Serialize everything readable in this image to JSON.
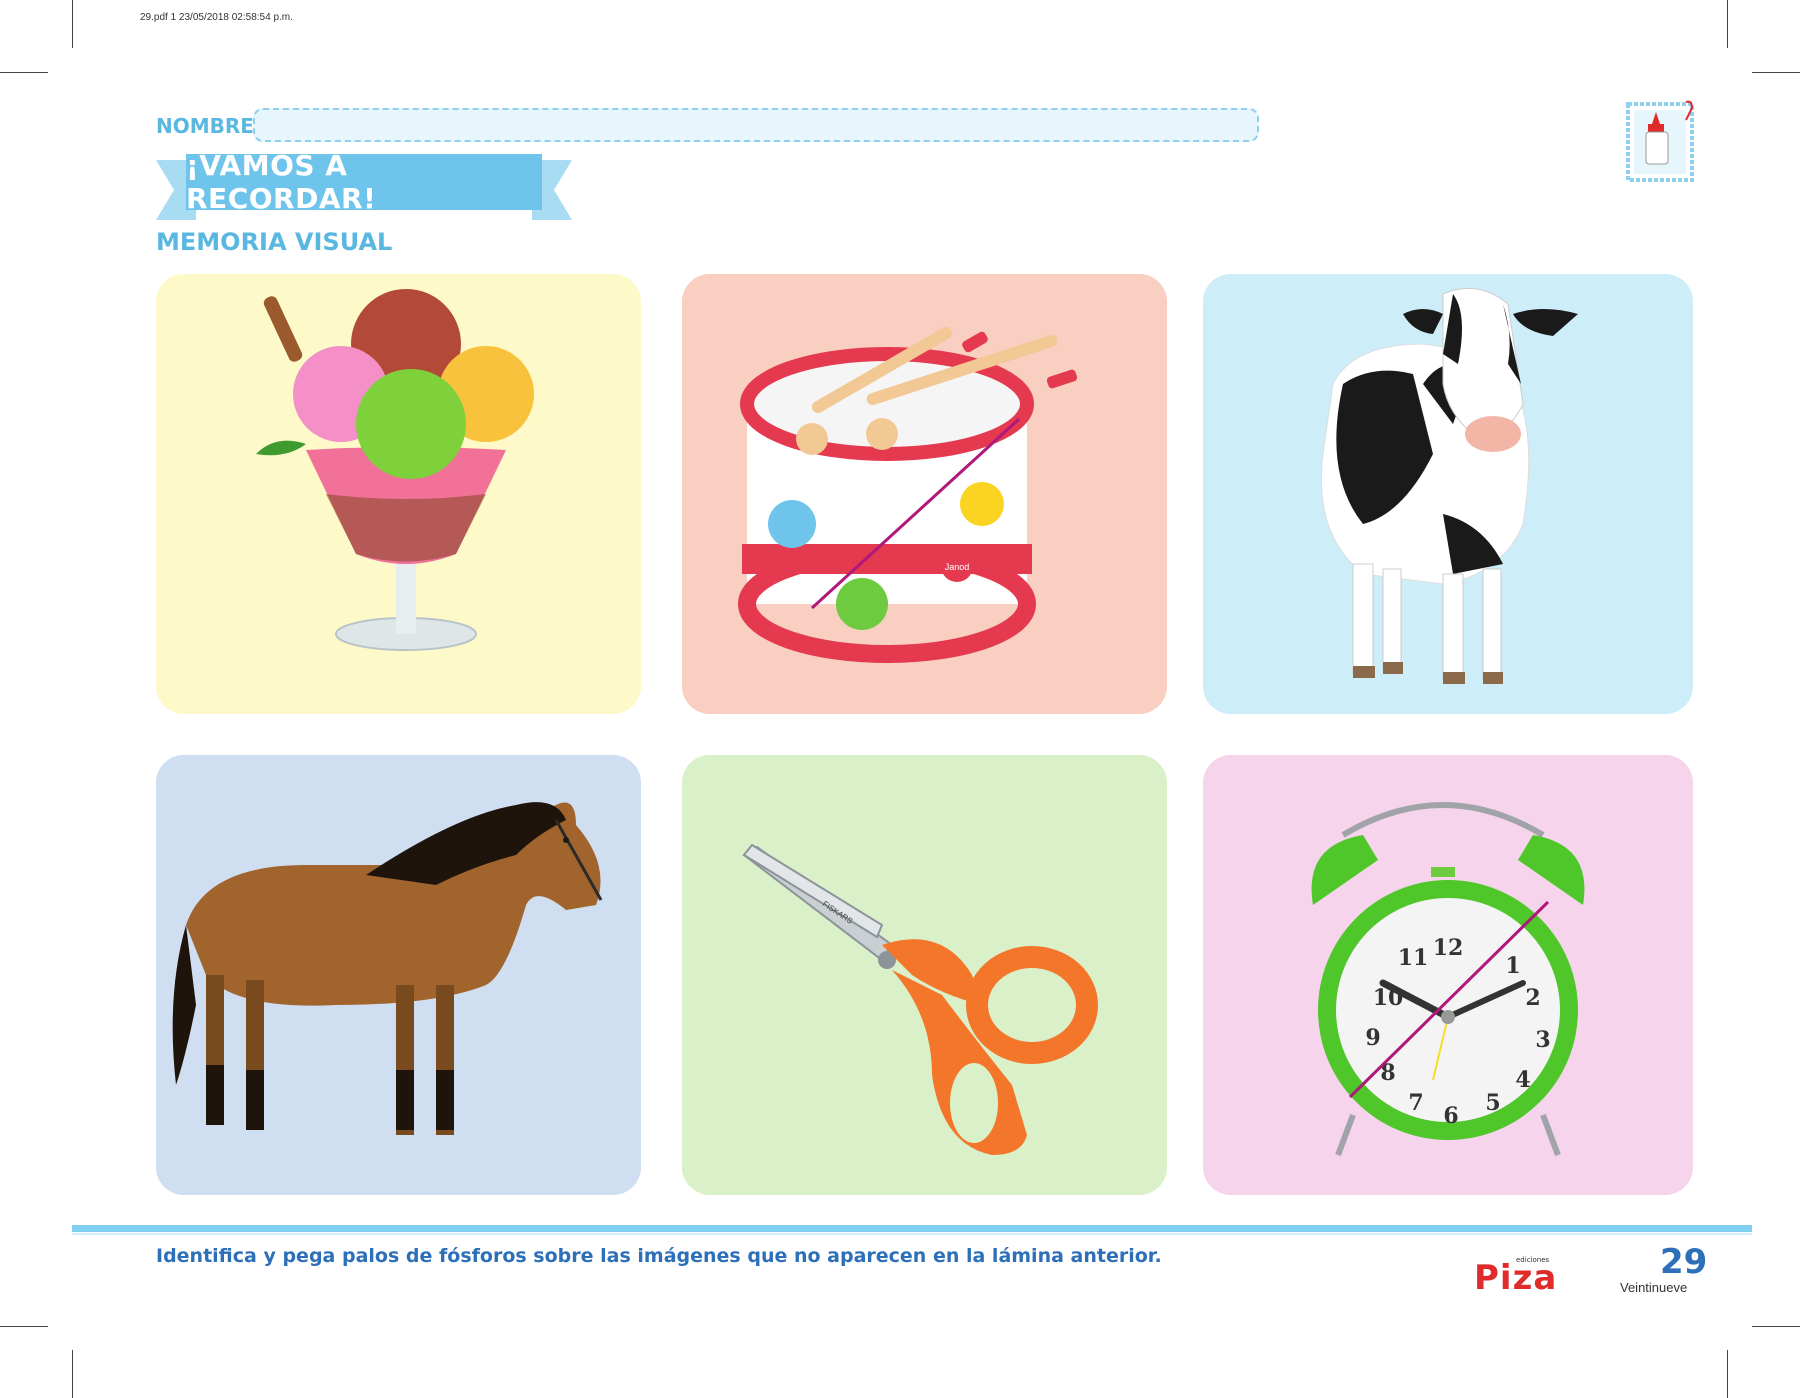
{
  "print_info": "29.pdf  1  23/05/2018  02:58:54 p.m.",
  "header": {
    "name_label": "NOMBRE:",
    "banner_title": "¡VAMOS A RECORDAR!",
    "subtitle": "MEMORIA VISUAL"
  },
  "cards": [
    {
      "subject": "ice-cream-sundae",
      "bg": "#fdf9c8",
      "crossed": false
    },
    {
      "subject": "toy-drum",
      "bg": "#f8cfc0",
      "crossed": true,
      "drum_brand": "Janod"
    },
    {
      "subject": "cow",
      "bg": "#cdeef8",
      "crossed": false
    },
    {
      "subject": "horse",
      "bg": "#cfdff1",
      "crossed": false
    },
    {
      "subject": "scissors",
      "bg": "#daf0c8",
      "crossed": false,
      "scissors_brand": "FISKARS"
    },
    {
      "subject": "alarm-clock",
      "bg": "#f6d4ec",
      "crossed": true
    }
  ],
  "footer": {
    "instruction": "Identifica y pega palos de fósforos sobre las imágenes que no aparecen en la lámina anterior.",
    "logo_text": "Piza",
    "logo_sub": "ediciones",
    "page_number": "29",
    "page_word": "Veintinueve"
  },
  "colors": {
    "accent_blue": "#5ab8e0",
    "banner": "#6ec4eb",
    "instruction_text": "#2d6fb8",
    "logo_red": "#e02b2b",
    "cross_line": "#b0187a"
  }
}
